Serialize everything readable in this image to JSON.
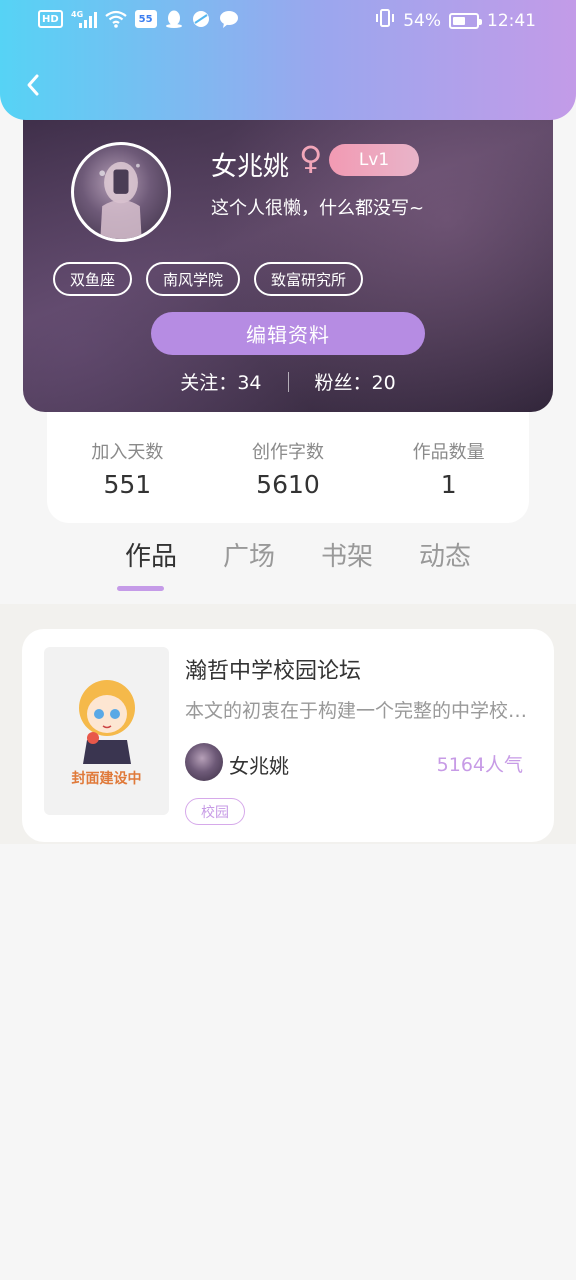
{
  "status_bar": {
    "left_icons": [
      "hd-icon",
      "signal-icon",
      "wifi-icon",
      "app-icon",
      "qq-icon",
      "browser-icon",
      "chat-icon"
    ],
    "hd_label": "HD",
    "network_label": "4G",
    "app_label": "55",
    "battery_percent": "54%",
    "battery_level": 0.54,
    "time": "12:41"
  },
  "profile": {
    "name": "女兆姚",
    "gender_symbol": "♀",
    "level": "Lv1",
    "bio": "这个人很懒，什么都没写~",
    "tags": [
      "双鱼座",
      "南风学院",
      "致富研究所"
    ],
    "edit_label": "编辑资料",
    "following_label": "关注：",
    "following_count": "34",
    "followers_label": "粉丝：",
    "followers_count": "20"
  },
  "stats": [
    {
      "label": "加入天数",
      "value": "551"
    },
    {
      "label": "创作字数",
      "value": "5610"
    },
    {
      "label": "作品数量",
      "value": "1"
    }
  ],
  "tabs": [
    {
      "label": "作品",
      "active": true
    },
    {
      "label": "广场",
      "active": false
    },
    {
      "label": "书架",
      "active": false
    },
    {
      "label": "动态",
      "active": false
    }
  ],
  "works": [
    {
      "cover_text": "封面建设中",
      "title": "瀚哲中学校园论坛",
      "description": "本文的初衷在于构建一个完整的中学校园论坛",
      "author": "女兆姚",
      "popularity": "5164人气",
      "tag": "校园"
    }
  ],
  "colors": {
    "header_gradient_start": "#56d3f5",
    "header_gradient_end": "#c39be8",
    "accent": "#c59be8",
    "edit_button": "#b68ce3",
    "level_badge": "#f29ab3"
  }
}
